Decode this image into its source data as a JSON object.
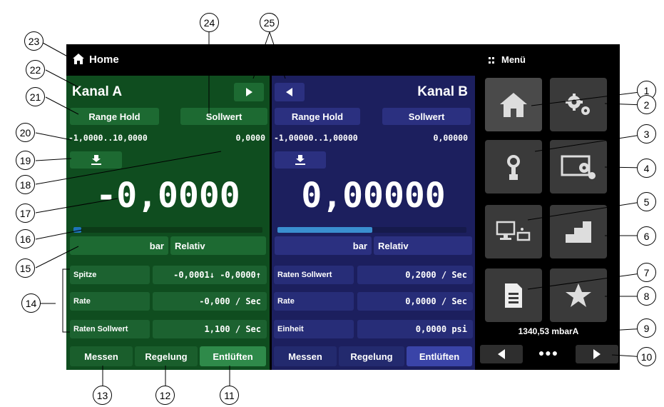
{
  "header": {
    "home_label": "Home",
    "menu_label": "Menü"
  },
  "channel_a": {
    "title": "Kanal A",
    "range_hold": "Range Hold",
    "setpoint": "Sollwert",
    "range": "-1,0000..10,0000",
    "setpoint_value": "0,0000",
    "reading": "-0,0000",
    "unit": "bar",
    "mode": "Relativ",
    "progress": 0.04,
    "rows": [
      {
        "label": "Spitze",
        "value": "-0,0001↓  -0,0000↑"
      },
      {
        "label": "Rate",
        "value": "-0,000 / Sec"
      },
      {
        "label": "Raten Sollwert",
        "value": "1,100 / Sec"
      }
    ],
    "tabs": [
      "Messen",
      "Regelung",
      "Entlüften"
    ]
  },
  "channel_b": {
    "title": "Kanal B",
    "range_hold": "Range Hold",
    "setpoint": "Sollwert",
    "range": "-1,00000..1,00000",
    "setpoint_value": "0,00000",
    "reading": "0,00000",
    "unit": "bar",
    "mode": "Relativ",
    "progress": 0.5,
    "rows": [
      {
        "label": "Raten Sollwert",
        "value": "0,2000 / Sec"
      },
      {
        "label": "Rate",
        "value": "0,0000 / Sec"
      },
      {
        "label": "Einheit",
        "value": "0,0000 psi"
      }
    ],
    "tabs": [
      "Messen",
      "Regelung",
      "Entlüften"
    ]
  },
  "right_panel": {
    "barometer": "1340,53 mbarA",
    "page_dots": "●●●"
  },
  "callouts": [
    "1",
    "2",
    "3",
    "4",
    "5",
    "6",
    "7",
    "8",
    "9",
    "10",
    "11",
    "12",
    "13",
    "14",
    "15",
    "16",
    "17",
    "18",
    "19",
    "20",
    "21",
    "22",
    "23",
    "24",
    "25"
  ],
  "colors": {
    "channel_a_bg": "#0f4d1f",
    "channel_b_bg": "#1c1f5e",
    "progress_a": "#1e73b8",
    "progress_b": "#3a8fd0",
    "active_tab": "#2f8a4a"
  }
}
